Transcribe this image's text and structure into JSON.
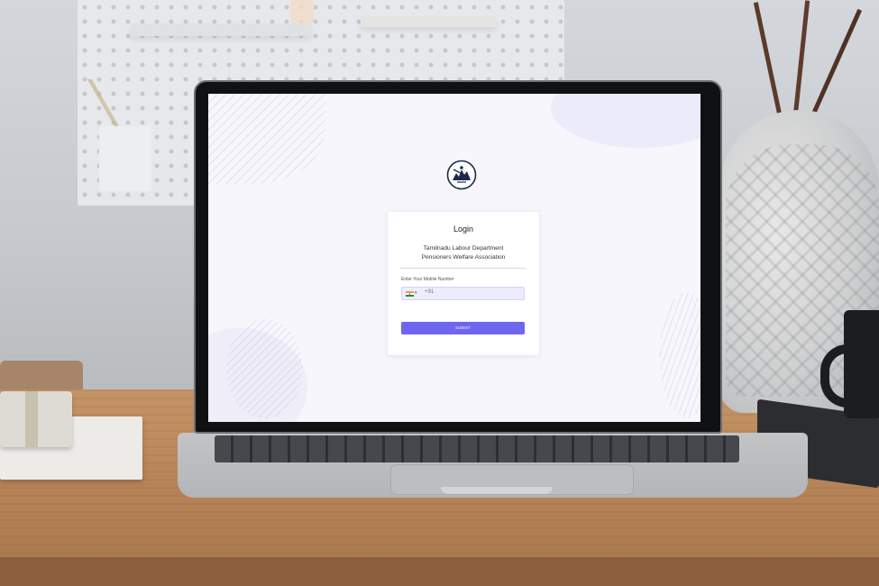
{
  "login_page": {
    "logo_icon": "association-emblem-icon",
    "logo_caption": "",
    "card": {
      "title": "Login",
      "org_name_line1": "Tamilnadu Labour Department",
      "org_name_line2": "Pensioners Welfare Association",
      "mobile_field": {
        "label": "Enter Your Mobile Number",
        "country_flag": "india-flag-icon",
        "dial_code": "+91",
        "value": ""
      },
      "submit_label": "SUBMIT"
    },
    "accent_color": "#6f66ef",
    "page_background": "#f6f6fc"
  }
}
